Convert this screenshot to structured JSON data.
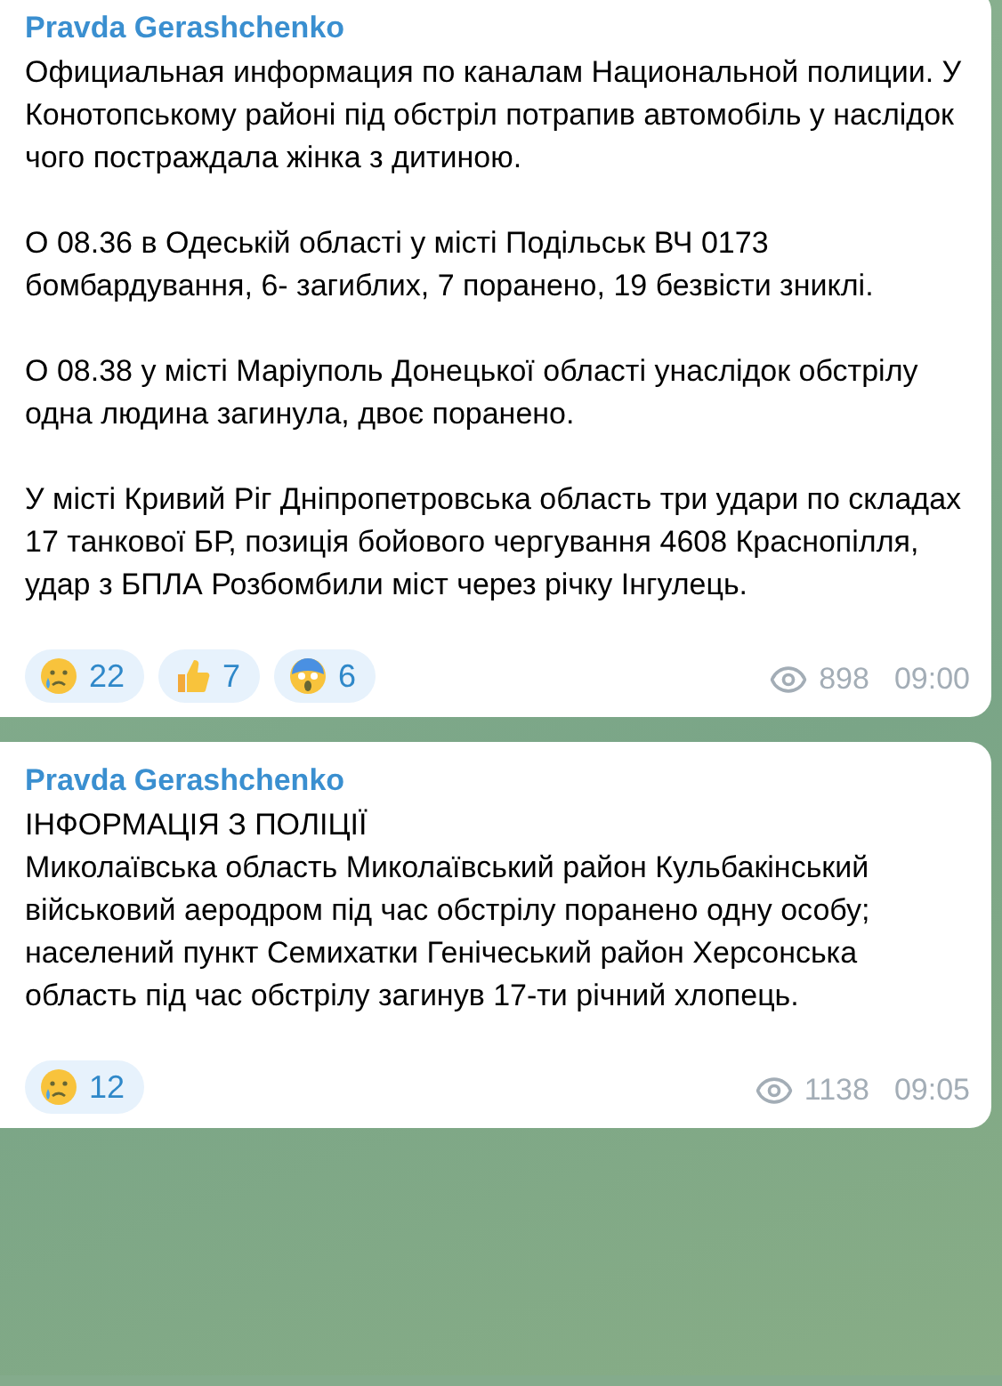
{
  "messages": [
    {
      "author": "Pravda Gerashchenko",
      "paragraphs": [
        "Официальная информация по каналам Национальной полиции. У Конотопському районі під обстріл потрапив автомобіль у наслідок чого постраждала жінка з дитиною.",
        "О 08.36 в Одеській області у місті Подільськ ВЧ 0173 бомбардування, 6- загиблих, 7 поранено, 19 безвісти зниклі.",
        "О 08.38 у місті Маріуполь Донецької області унаслідок обстрілу одна людина загинула, двоє поранено.",
        "У місті Кривий Ріг Дніпропетровська область три удари по складах 17 танкової БР, позиція бойового чергування 4608 Краснопілля, удар з БПЛА Розбомбили міст через річку Інгулець."
      ],
      "reactions": [
        {
          "kind": "crying",
          "count": "22"
        },
        {
          "kind": "thumbs-up",
          "count": "7"
        },
        {
          "kind": "scream",
          "count": "6"
        }
      ],
      "views": "898",
      "time": "09:00"
    },
    {
      "author": "Pravda Gerashchenko",
      "paragraphs": [
        "ІНФОРМАЦІЯ З ПОЛІЦІЇ\nМиколаївська область Миколаївський район Кульбакінський військовий аеродром під час обстрілу поранено одну особу;\nнаселений пункт Семихатки Генічеський район Херсонська область під час обстрілу загинув 17-ти річний хлопець."
      ],
      "reactions": [
        {
          "kind": "crying",
          "count": "12"
        }
      ],
      "views": "1138",
      "time": "09:05"
    }
  ]
}
